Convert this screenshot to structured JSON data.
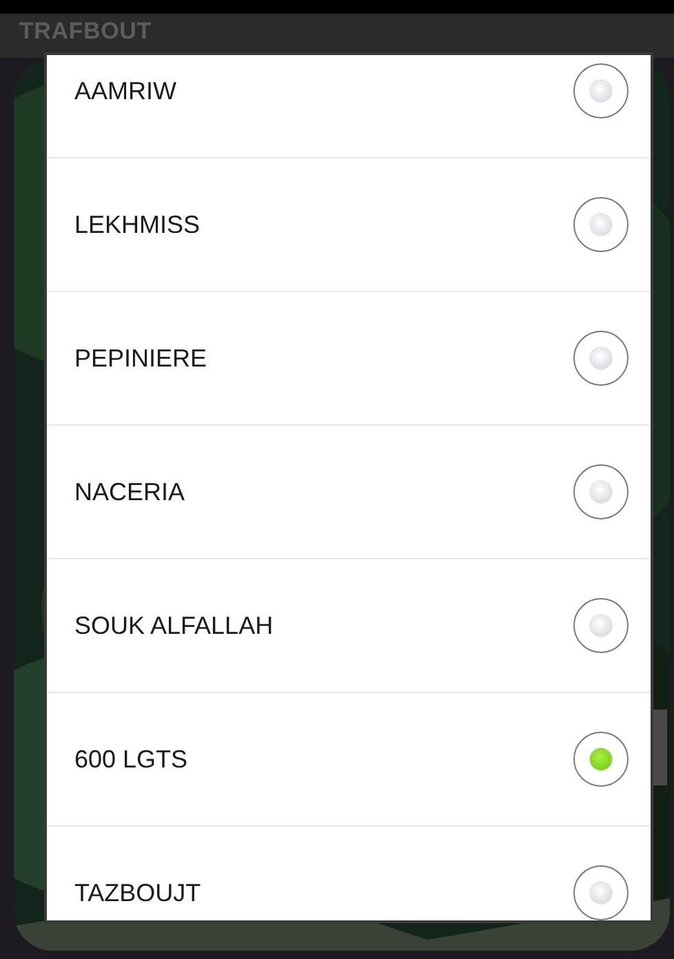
{
  "app_bar": {
    "title": "TRAFBOUT"
  },
  "dialog": {
    "options": [
      {
        "label": "AAMRIW",
        "selected": false
      },
      {
        "label": "LEKHMISS",
        "selected": false
      },
      {
        "label": "PEPINIERE",
        "selected": false
      },
      {
        "label": "NACERIA",
        "selected": false
      },
      {
        "label": "SOUK ALFALLAH",
        "selected": false
      },
      {
        "label": "600 LGTS",
        "selected": true
      },
      {
        "label": "TAZBOUJT",
        "selected": false
      }
    ]
  }
}
